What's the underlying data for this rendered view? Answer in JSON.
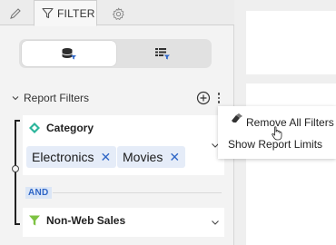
{
  "tabs": {
    "edit_icon": "pencil-icon",
    "filter_label": "FILTER",
    "filter_icon": "funnel-icon",
    "settings_icon": "gear-icon"
  },
  "view_toggle": {
    "options": [
      {
        "icon": "database-filter-icon",
        "active": true
      },
      {
        "icon": "table-filter-icon",
        "active": false
      }
    ]
  },
  "report_filters": {
    "title": "Report Filters",
    "add_icon": "plus-circle-icon",
    "more_icon": "vertical-ellipsis-icon"
  },
  "filters": [
    {
      "name": "Category",
      "icon": "attribute-diamond-icon",
      "chips": [
        "Electronics",
        "Movies"
      ]
    },
    {
      "name": "Non-Web Sales",
      "icon": "metric-funnel-icon"
    }
  ],
  "operator": "AND",
  "context_menu": {
    "items": [
      "Remove All Filters",
      "Show Report Limits"
    ]
  },
  "colors": {
    "accent": "#2f66c6",
    "category_icon": "#2bb59b",
    "metric_icon": "#7dc242",
    "chip_bg": "#e5ecf8"
  }
}
